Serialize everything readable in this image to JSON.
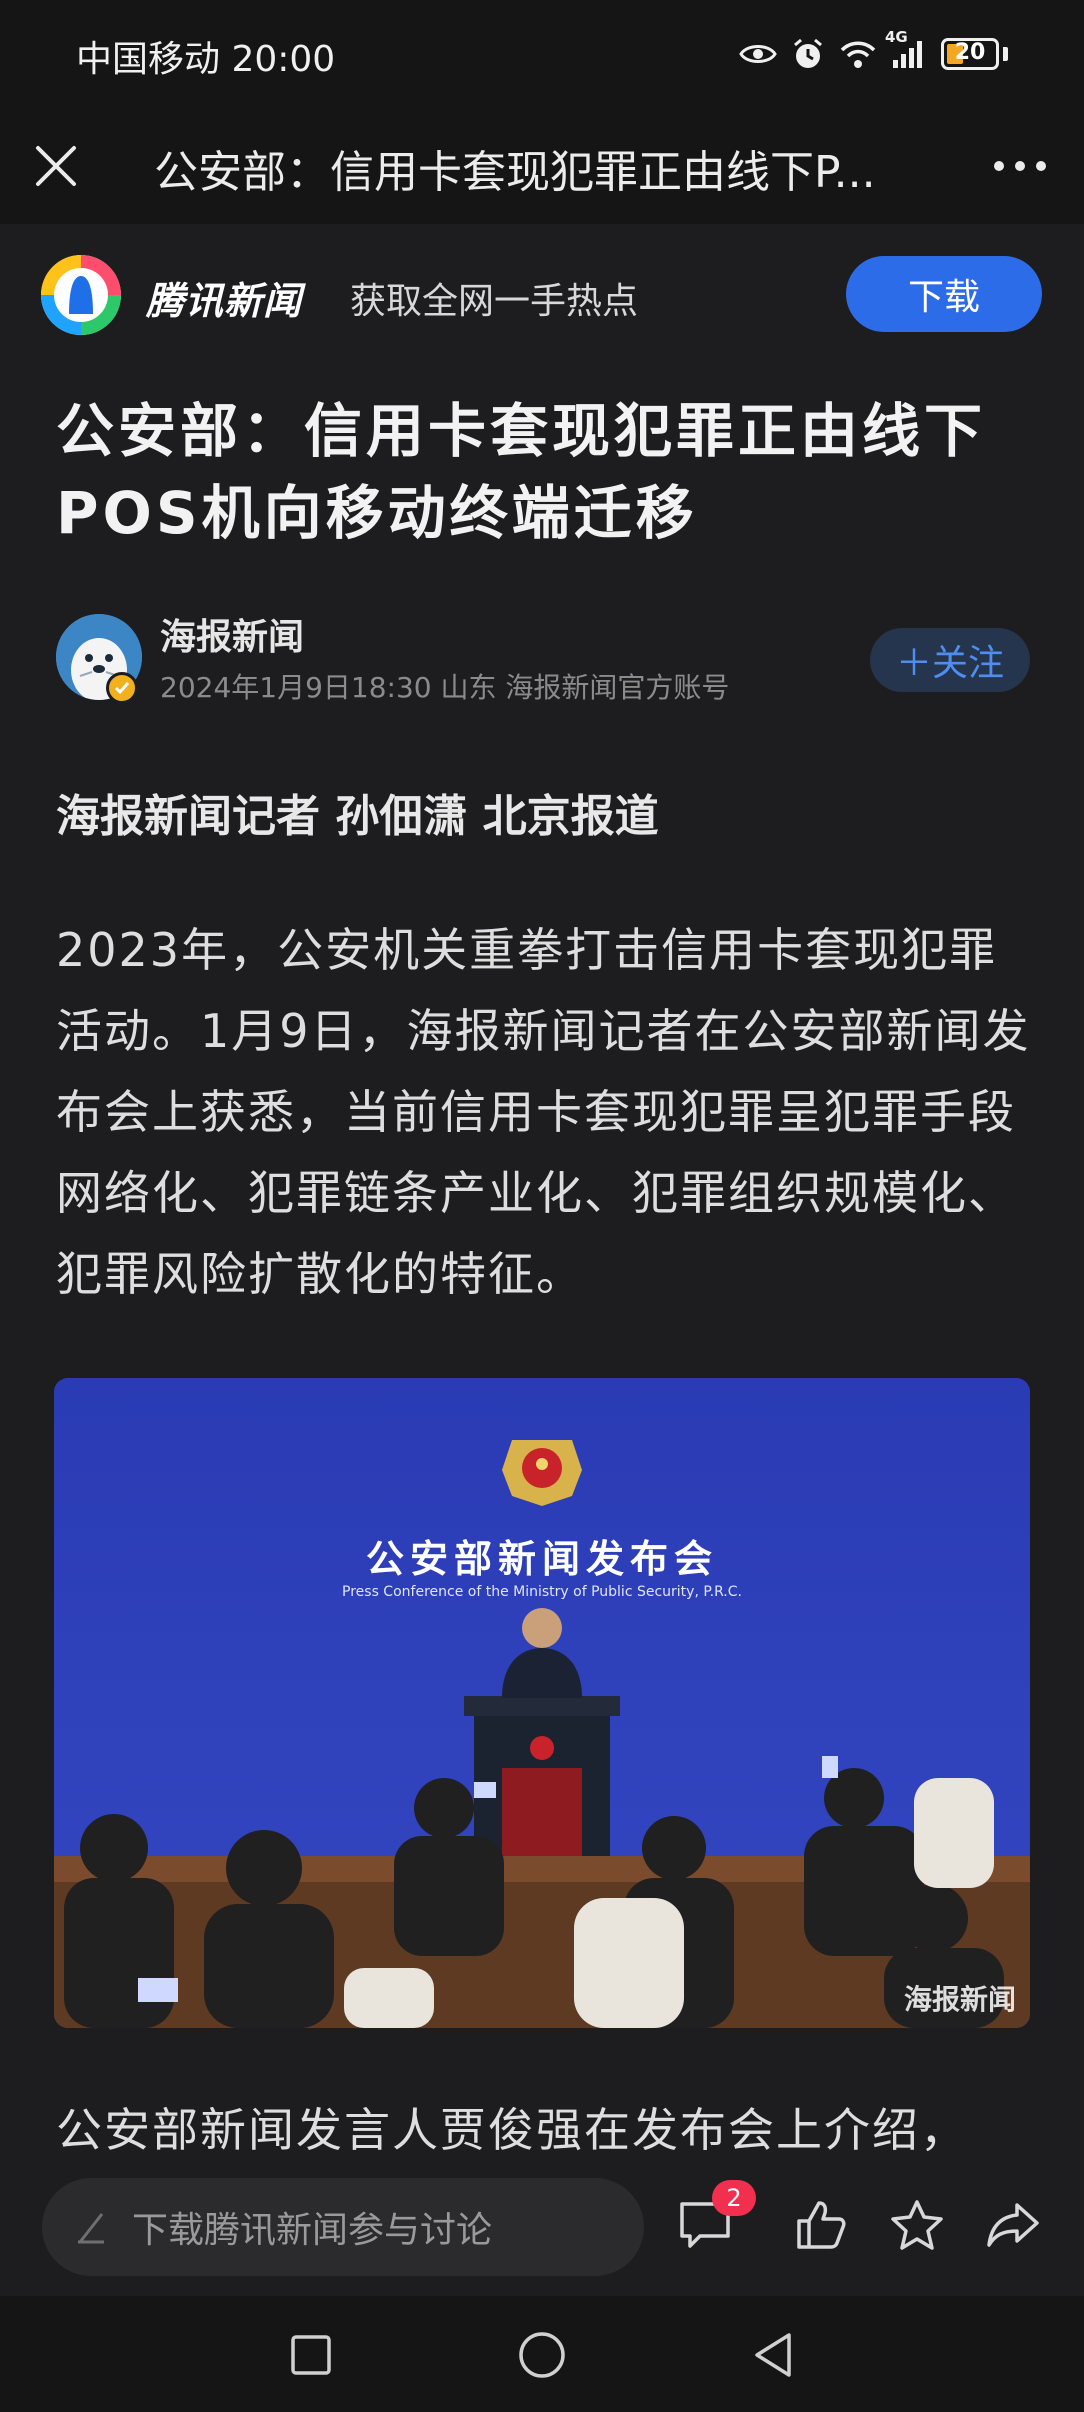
{
  "status_bar": {
    "carrier_time": "中国移动 20:00",
    "network": "4G",
    "battery": "20",
    "icons": [
      "eye-icon",
      "alarm-icon",
      "wifi-icon",
      "signal-icon",
      "battery-icon"
    ]
  },
  "title_bar": {
    "title": "公安部：信用卡套现犯罪正由线下P...",
    "close_icon": "close-icon",
    "more_icon": "more-icon"
  },
  "promo": {
    "brand": "腾讯新闻",
    "slogan": "获取全网一手热点",
    "download_label": "下载",
    "accent": "#2d6ce8"
  },
  "article": {
    "headline": "公安部：信用卡套现犯罪正由线下POS机向移动终端迁移",
    "author": {
      "name": "海报新闻",
      "meta": "2024年1月9日18:30  山东  海报新闻官方账号",
      "follow_label": "＋关注"
    },
    "byline": "海报新闻记者 孙佃潇 北京报道",
    "paragraph1": "2023年，公安机关重拳打击信用卡套现犯罪活动。1月9日，海报新闻记者在公安部新闻发布会上获悉，当前信用卡套现犯罪呈犯罪手段网络化、犯罪链条产业化、犯罪组织规模化、犯罪风险扩散化的特征。",
    "photo": {
      "title": "公安部新闻发布会",
      "subtitle": "Press Conference of the Ministry of Public Security, P.R.C.",
      "watermark": "海报新闻"
    },
    "paragraph2": "公安部新闻发言人贾俊强在发布会上介绍，"
  },
  "action_bar": {
    "comment_placeholder": "下载腾讯新闻参与讨论",
    "comment_count": "2",
    "icons": [
      "comment-icon",
      "like-icon",
      "star-icon",
      "share-icon"
    ]
  },
  "nav_bar": {
    "icons": [
      "recent-apps-icon",
      "home-icon",
      "back-icon"
    ]
  }
}
